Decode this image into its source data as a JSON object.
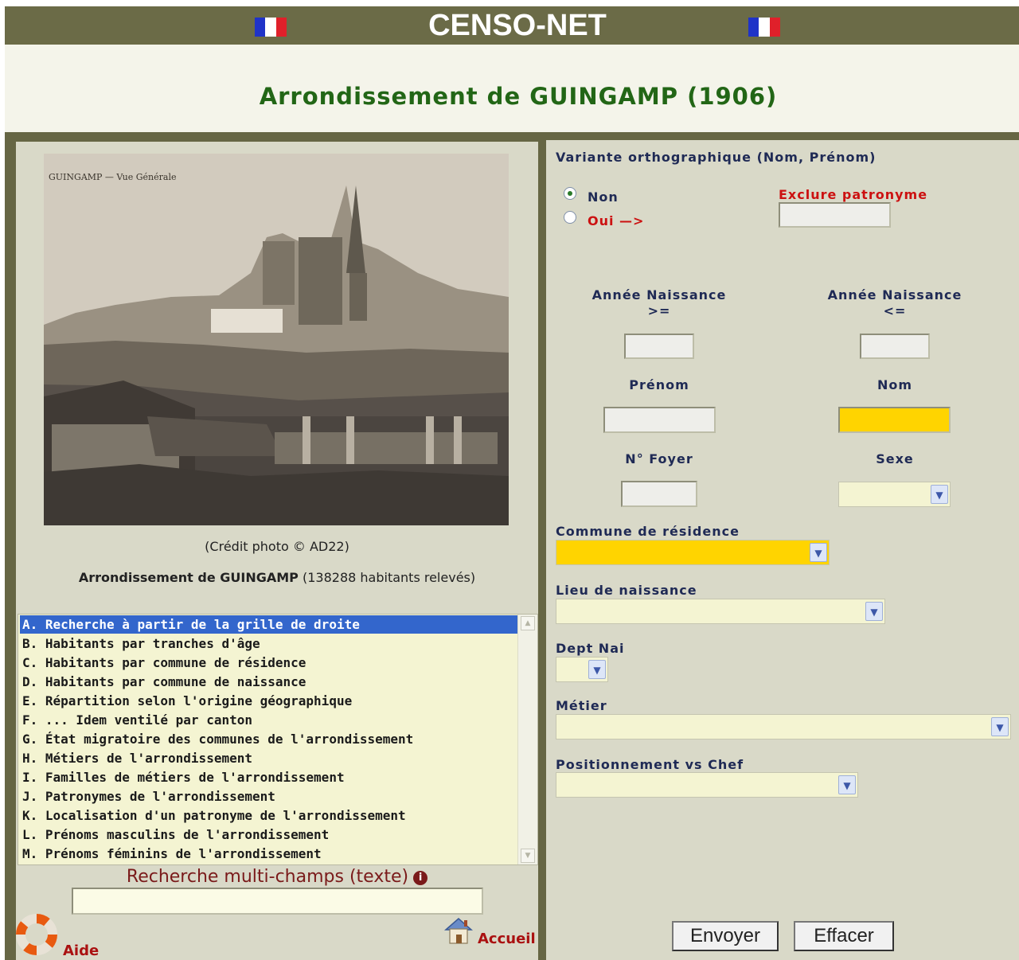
{
  "header": {
    "site_title": "CENSO-NET",
    "page_title": "Arrondissement de GUINGAMP (1906)"
  },
  "photo": {
    "inscription": "GUINGAMP — Vue Générale",
    "credit": "(Crédit photo © AD22)",
    "summary_bold": "Arrondissement de GUINGAMP",
    "summary_rest": " (138288 habitants relevés)"
  },
  "menu": {
    "items": [
      "A. Recherche à partir de la grille de droite",
      "B. Habitants par tranches d'âge",
      "C. Habitants par commune de résidence",
      "D. Habitants par commune de naissance",
      "E. Répartition selon l'origine géographique",
      "F. ... Idem ventilé par canton",
      "G. État migratoire des communes de l'arrondissement",
      "H. Métiers de l'arrondissement",
      "I. Familles de métiers de l'arrondissement",
      "J. Patronymes de l'arrondissement",
      "K. Localisation d'un patronyme de l'arrondissement",
      "L. Prénoms masculins de l'arrondissement",
      "M. Prénoms féminins de l'arrondissement"
    ],
    "selected_index": 0
  },
  "multi_search": {
    "label": "Recherche multi-champs (texte)",
    "value": ""
  },
  "footer": {
    "help_label": "Aide",
    "home_label": "Accueil"
  },
  "form": {
    "variant_label": "Variante orthographique (Nom, Prénom)",
    "radio_non": "Non",
    "radio_oui": "Oui —>",
    "variant_selected": "Non",
    "exclude_label": "Exclure patronyme",
    "birth_year_min_label": "Année Naissance",
    "birth_year_min_op": ">=",
    "birth_year_max_label": "Année Naissance",
    "birth_year_max_op": "<=",
    "firstname_label": "Prénom",
    "lastname_label": "Nom",
    "household_label": "N° Foyer",
    "sex_label": "Sexe",
    "commune_label": "Commune de résidence",
    "birthplace_label": "Lieu de naissance",
    "dept_label": "Dept Nai",
    "job_label": "Métier",
    "position_label": "Positionnement vs Chef",
    "values": {
      "exclude": "",
      "birth_min": "",
      "birth_max": "",
      "firstname": "",
      "lastname": "",
      "household": "",
      "sex": "",
      "commune": "",
      "birthplace": "",
      "dept": "",
      "job": "",
      "position": ""
    }
  },
  "buttons": {
    "submit": "Envoyer",
    "reset": "Effacer"
  },
  "colors": {
    "header": "#6b6b47",
    "title_green": "#226616",
    "panel": "#d9d9c8",
    "highlight_yellow": "#ffd400",
    "selection_blue": "#3366cc",
    "label_navy": "#1f2a55",
    "accent_red": "#cc1111"
  }
}
